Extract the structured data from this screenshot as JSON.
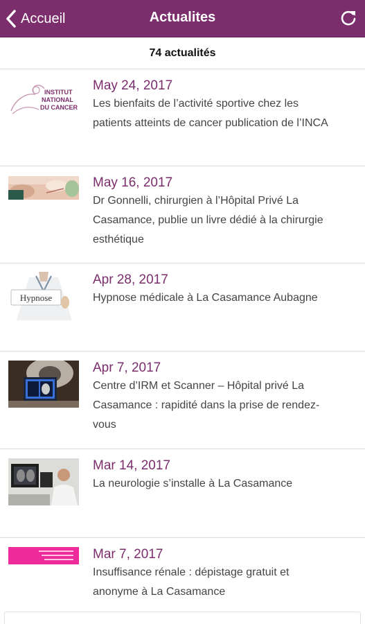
{
  "nav": {
    "back_label": "Accueil",
    "title": "Actualites",
    "refresh_icon": "refresh-icon",
    "back_icon": "chevron-left-icon"
  },
  "news_count": "74 actualités",
  "colors": {
    "brand": "#7b2d6c",
    "date_text": "#7b2d6c",
    "body_text": "#444444",
    "divider": "#dcdcdc"
  },
  "news": [
    {
      "date": "May 24, 2017",
      "text": "Les bienfaits de l’activité sportive chez les patients atteints de cancer publication de l’INCA",
      "thumb_text_lines": [
        "INSTITUT",
        "NATIONAL",
        "DU CANCER"
      ]
    },
    {
      "date": "May 16, 2017",
      "text": "Dr Gonnelli, chirurgien à l’Hôpital Privé La Casamance, publie un livre dédié à la chirurgie esthétique"
    },
    {
      "date": "Apr 28, 2017",
      "text": "Hypnose médicale à La Casamance Aubagne",
      "thumb_text": "Hypnose"
    },
    {
      "date": "Apr 7, 2017",
      "text": "Centre d’IRM et Scanner – Hôpital privé La Casamance : rapidité dans la prise de rendez-vous"
    },
    {
      "date": "Mar 14, 2017",
      "text": "La neurologie s’installe à La Casamance"
    },
    {
      "date": "Mar 7, 2017",
      "text": "Insuffisance rénale : dépistage gratuit et anonyme à La Casamance"
    }
  ]
}
